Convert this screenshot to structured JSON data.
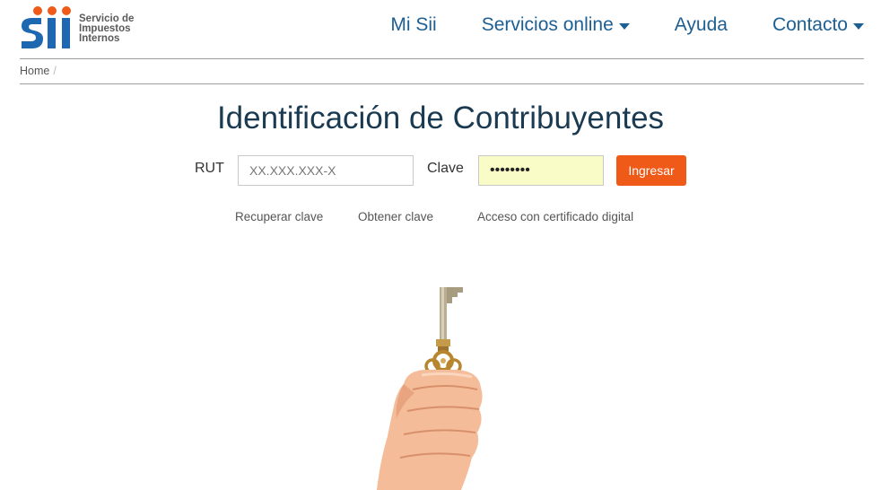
{
  "brand": {
    "line1": "Servicio de",
    "line2": "Impuestos",
    "line3": "Internos",
    "colors": {
      "logo_blue": "#1d68b0",
      "logo_orange": "#f05a19"
    }
  },
  "nav": {
    "items": [
      {
        "label": "Mi Sii",
        "dropdown": false
      },
      {
        "label": "Servicios online",
        "dropdown": true
      },
      {
        "label": "Ayuda",
        "dropdown": false
      },
      {
        "label": "Contacto",
        "dropdown": true
      }
    ]
  },
  "breadcrumb": {
    "home": "Home",
    "separator": "/"
  },
  "page": {
    "title": "Identificación de Contribuyentes"
  },
  "form": {
    "rut_label": "RUT",
    "rut_placeholder": "XX.XXX.XXX-X",
    "rut_value": "",
    "clave_label": "Clave",
    "clave_value": "12345678",
    "submit_label": "Ingresar"
  },
  "links": {
    "recuperar": "Recuperar clave",
    "obtener": "Obtener clave",
    "certificado": "Acceso con certificado digital"
  },
  "hero": {
    "icon": "hand-holding-key-icon"
  },
  "colors": {
    "nav_text": "#1d5f93",
    "title_text": "#1a3a52",
    "button_bg": "#f05a19",
    "password_bg": "#fafcc8"
  }
}
